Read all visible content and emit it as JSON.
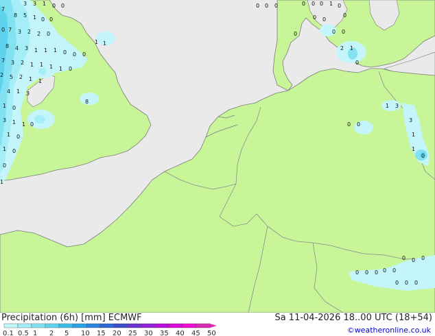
{
  "legend": {
    "title": "Precipitation (6h) [mm] ECMWF",
    "ticks": [
      "0.1",
      "0.5",
      "1",
      "2",
      "5",
      "10",
      "15",
      "20",
      "25",
      "30",
      "35",
      "40",
      "45",
      "50"
    ],
    "colors": [
      "#c4f5fb",
      "#a5edf7",
      "#83e2f2",
      "#5fd3ee",
      "#3dbeea",
      "#2aa2e3",
      "#2a84dc",
      "#2f66d3",
      "#3a4cc6",
      "#6b34d0",
      "#9322d7",
      "#b610da",
      "#d808d8",
      "#f00ed4",
      "#d92ab4"
    ]
  },
  "datetime": "Sa 11-04-2026 18..00 UTC (18+54)",
  "credit": "©weatheronline.co.uk",
  "colors": {
    "land": "#c7f598",
    "sea": "#eaeaea",
    "border": "#8b8b8b",
    "coast": "#7a7a7a"
  },
  "map_values": [
    {
      "t": "3"
    },
    {
      "t": "3"
    },
    {
      "t": "1"
    },
    {
      "t": "0"
    },
    {
      "t": "0"
    },
    {
      "t": "0"
    },
    {
      "t": "0"
    },
    {
      "t": "0"
    },
    {
      "t": "0"
    },
    {
      "t": "0"
    },
    {
      "t": "0"
    },
    {
      "t": "1"
    },
    {
      "t": "0"
    },
    {
      "t": "7"
    },
    {
      "t": "8"
    },
    {
      "t": "5"
    },
    {
      "t": "1"
    },
    {
      "t": "0"
    },
    {
      "t": "0"
    },
    {
      "t": "0"
    },
    {
      "t": "0"
    },
    {
      "t": "0"
    },
    {
      "t": "0"
    },
    {
      "t": "7"
    },
    {
      "t": "3"
    },
    {
      "t": "2"
    },
    {
      "t": "2"
    },
    {
      "t": "0"
    },
    {
      "t": "0"
    },
    {
      "t": "0"
    },
    {
      "t": "0"
    },
    {
      "t": "1"
    },
    {
      "t": "1"
    },
    {
      "t": "8"
    },
    {
      "t": "4"
    },
    {
      "t": "3"
    },
    {
      "t": "1"
    },
    {
      "t": "1"
    },
    {
      "t": "1"
    },
    {
      "t": "0"
    },
    {
      "t": "0"
    },
    {
      "t": "0"
    },
    {
      "t": "2"
    },
    {
      "t": "1"
    },
    {
      "t": "7"
    },
    {
      "t": "3"
    },
    {
      "t": "2"
    },
    {
      "t": "1"
    },
    {
      "t": "1"
    },
    {
      "t": "1"
    },
    {
      "t": "1"
    },
    {
      "t": "0"
    },
    {
      "t": "0"
    },
    {
      "t": "2"
    },
    {
      "t": "5"
    },
    {
      "t": "2"
    },
    {
      "t": "1"
    },
    {
      "t": "1"
    },
    {
      "t": "4"
    },
    {
      "t": "1"
    },
    {
      "t": "3"
    },
    {
      "t": "1"
    },
    {
      "t": "0"
    },
    {
      "t": "8"
    },
    {
      "t": "3"
    },
    {
      "t": "1"
    },
    {
      "t": "1"
    },
    {
      "t": "1"
    },
    {
      "t": "3"
    },
    {
      "t": "1"
    },
    {
      "t": "0"
    },
    {
      "t": "0"
    },
    {
      "t": "0"
    },
    {
      "t": "0"
    },
    {
      "t": "3"
    },
    {
      "t": "1"
    },
    {
      "t": "0"
    },
    {
      "t": "1"
    },
    {
      "t": "0"
    },
    {
      "t": "1"
    },
    {
      "t": "1"
    },
    {
      "t": "0"
    },
    {
      "t": "0"
    },
    {
      "t": "0"
    },
    {
      "t": "0"
    },
    {
      "t": "0"
    },
    {
      "t": "0"
    },
    {
      "t": "0"
    },
    {
      "t": "0"
    },
    {
      "t": "0"
    },
    {
      "t": "0"
    },
    {
      "t": "0"
    },
    {
      "t": "0"
    }
  ]
}
